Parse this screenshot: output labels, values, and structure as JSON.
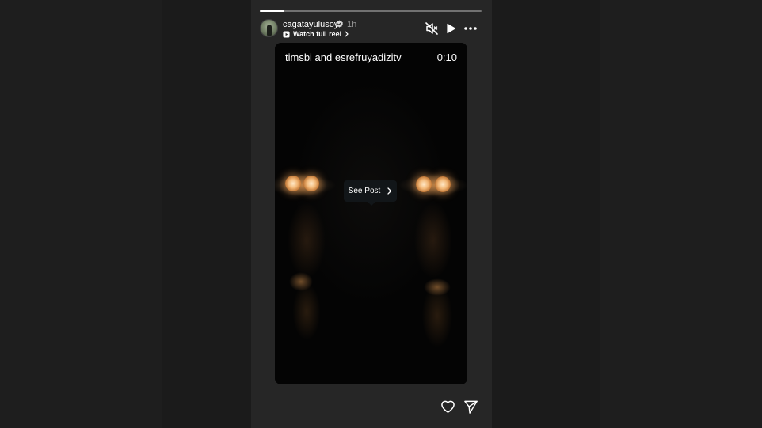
{
  "story": {
    "username": "cagatayulusoy",
    "verified": true,
    "timestamp": "1h",
    "watch_reel_label": "Watch full reel",
    "progress_fraction": 0.11
  },
  "video": {
    "title": "timsbi and esrefruyadizitv",
    "time": "0:10",
    "see_post_label": "See Post"
  },
  "icons": {
    "verified": "verified-badge-icon",
    "reel": "reel-icon",
    "mute": "muted-speaker-icon",
    "play": "play-icon",
    "more": "more-options-icon",
    "like": "heart-icon",
    "share": "send-icon"
  },
  "colors": {
    "background": "#1b1b1b",
    "panel": "#262626",
    "text": "#ffffff",
    "muted_text": "#9a9a9a"
  }
}
